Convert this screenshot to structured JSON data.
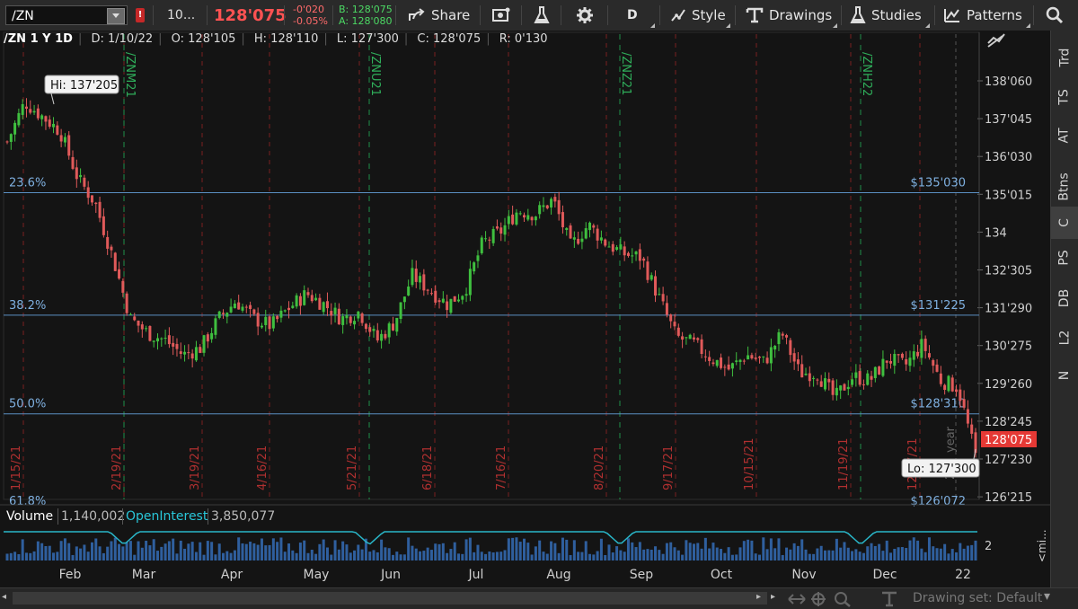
{
  "toolbar": {
    "symbol": "/ZN",
    "alert_badge": "!",
    "qty": "10...",
    "last_price": "128'075",
    "change": "-0'020",
    "change_pct": "-0.05%",
    "bid": "B: 128'075",
    "ask": "A: 128'080",
    "share_label": "Share",
    "timeframe_label": "D",
    "style_label": "Style",
    "drawings_label": "Drawings",
    "studies_label": "Studies",
    "patterns_label": "Patterns",
    "icons": [
      "share-icon",
      "screenshot-icon",
      "flask-icon",
      "gear-icon",
      "style-icon",
      "drawings-icon",
      "studies-icon",
      "patterns-icon",
      "search-icon"
    ]
  },
  "chart_header": {
    "symbol": "/ZN 1 Y 1D",
    "date": "D: 1/10/22",
    "open": "O: 128'105",
    "high": "H: 128'110",
    "low": "L: 127'300",
    "close": "C: 128'075",
    "range": "R: 0'130"
  },
  "right_tabs": [
    "Trd",
    "TS",
    "AT",
    "Btns",
    "C",
    "PS",
    "DB",
    "L2",
    "N"
  ],
  "active_right_tab": "C",
  "chart_data": {
    "type": "candlestick",
    "y_ticks": [
      "138'060",
      "137'045",
      "136'030",
      "135'015",
      "134",
      "132'305",
      "131'290",
      "130'275",
      "129'260",
      "128'245",
      "127'230",
      "126'215"
    ],
    "x_months": [
      "Feb",
      "Mar",
      "Apr",
      "May",
      "Jun",
      "Jul",
      "Aug",
      "Sep",
      "Oct",
      "Nov",
      "Dec",
      "22"
    ],
    "expiry_dates": [
      "1/15/21",
      "2/19/21",
      "3/19/21",
      "4/16/21",
      "5/21/21",
      "6/18/21",
      "7/16/21",
      "8/20/21",
      "9/17/21",
      "10/15/21",
      "11/19/21",
      "12/17/21"
    ],
    "contract_rolls": [
      "/ZNM21",
      "/ZNU21",
      "/ZNZ21",
      "/ZNH22"
    ],
    "fib_levels": [
      {
        "pct": "23.6%",
        "price": "$135'030"
      },
      {
        "pct": "38.2%",
        "price": "$131'225"
      },
      {
        "pct": "50.0%",
        "price": "$128'310"
      }
    ],
    "hi_label": "Hi: 137'205",
    "lo_label": "Lo: 127'300",
    "current_price": "128'075",
    "year_marker": "year",
    "year_marker_2": "2",
    "partial_label": "61.8%",
    "partial_price": "$126'072",
    "close_path": [
      136.5,
      137.6,
      137.2,
      136.8,
      135.5,
      134.8,
      133.3,
      131.6,
      131.2,
      131.0,
      130.6,
      130.8,
      131.6,
      132.1,
      131.6,
      131.4,
      131.9,
      132.3,
      132.0,
      131.6,
      131.8,
      131.0,
      131.5,
      132.8,
      132.4,
      132.0,
      132.4,
      133.7,
      134.0,
      134.6,
      134.5,
      134.9,
      133.6,
      134.2,
      133.7,
      133.4,
      133.3,
      132.2,
      131.1,
      130.9,
      130.5,
      130.2,
      130.6,
      130.4,
      131.2,
      130.1,
      130.1,
      129.4,
      130.0,
      129.9,
      130.5,
      130.3,
      130.9,
      129.9,
      129.7,
      127.8
    ],
    "volume_axis_label": "2",
    "side_label": "<mi..."
  },
  "volume_panel": {
    "volume_label": "Volume",
    "volume_value": "1,140,002",
    "oi_label": "OpenInterest",
    "oi_value": "3,850,077"
  },
  "bottom": {
    "drawing_set": "Drawing set: Default"
  },
  "colors": {
    "up": "#3fbf3f",
    "down": "#e05a5a",
    "fib": "#5b8fc2",
    "price_tag": "#e53935",
    "volume_line": "#29b6c8",
    "volume_bars": "#2f5f9e"
  }
}
